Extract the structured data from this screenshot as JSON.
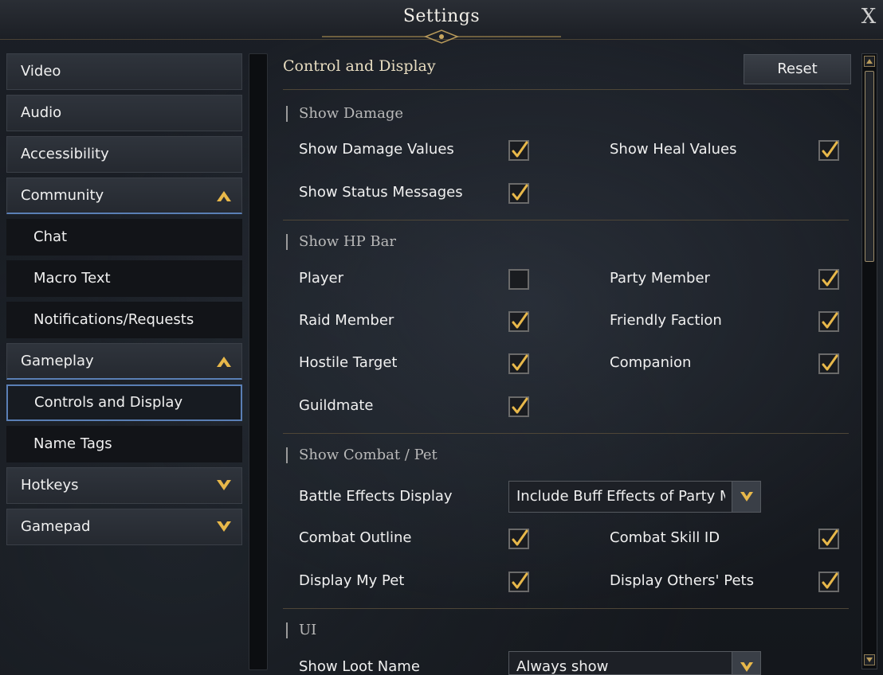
{
  "window": {
    "title": "Settings",
    "close_label": "X"
  },
  "sidebar": {
    "items": [
      {
        "label": "Video",
        "type": "main"
      },
      {
        "label": "Audio",
        "type": "main"
      },
      {
        "label": "Accessibility",
        "type": "main"
      },
      {
        "label": "Community",
        "type": "main",
        "expanded": true
      },
      {
        "label": "Chat",
        "type": "sub"
      },
      {
        "label": "Macro Text",
        "type": "sub"
      },
      {
        "label": "Notifications/Requests",
        "type": "sub"
      },
      {
        "label": "Gameplay",
        "type": "main",
        "expanded": true
      },
      {
        "label": "Controls and Display",
        "type": "sub",
        "selected": true
      },
      {
        "label": "Name Tags",
        "type": "sub"
      },
      {
        "label": "Hotkeys",
        "type": "main",
        "expanded": false
      },
      {
        "label": "Gamepad",
        "type": "main",
        "expanded": false
      }
    ]
  },
  "panel": {
    "title": "Control and Display",
    "reset_label": "Reset",
    "sections": {
      "show_damage": {
        "title": "Show Damage",
        "options": {
          "damage_values": {
            "label": "Show Damage Values",
            "checked": true
          },
          "heal_values": {
            "label": "Show Heal Values",
            "checked": true
          },
          "status_messages": {
            "label": "Show Status Messages",
            "checked": true
          }
        }
      },
      "show_hp_bar": {
        "title": "Show HP Bar",
        "options": {
          "player": {
            "label": "Player",
            "checked": false
          },
          "party_member": {
            "label": "Party Member",
            "checked": true
          },
          "raid_member": {
            "label": "Raid Member",
            "checked": true
          },
          "friendly_faction": {
            "label": "Friendly Faction",
            "checked": true
          },
          "hostile_target": {
            "label": "Hostile Target",
            "checked": true
          },
          "companion": {
            "label": "Companion",
            "checked": true
          },
          "guildmate": {
            "label": "Guildmate",
            "checked": true
          }
        }
      },
      "show_combat_pet": {
        "title": "Show Combat / Pet",
        "options": {
          "battle_effects": {
            "label": "Battle Effects Display",
            "value": "Include Buff Effects of Party M"
          },
          "combat_outline": {
            "label": "Combat Outline",
            "checked": true
          },
          "combat_skill_id": {
            "label": "Combat Skill ID",
            "checked": true
          },
          "my_pet": {
            "label": "Display My Pet",
            "checked": true
          },
          "others_pets": {
            "label": "Display Others' Pets",
            "checked": true
          }
        }
      },
      "ui": {
        "title": "UI",
        "options": {
          "loot_name": {
            "label": "Show Loot Name",
            "value": "Always show"
          }
        }
      }
    }
  },
  "colors": {
    "accent_gold": "#e8b84a",
    "selection_blue": "#5a7fb5"
  },
  "icons": {
    "check": "check-icon",
    "chevron_up": "chevron-up-icon",
    "chevron_down": "chevron-down-icon",
    "close": "close-icon"
  }
}
